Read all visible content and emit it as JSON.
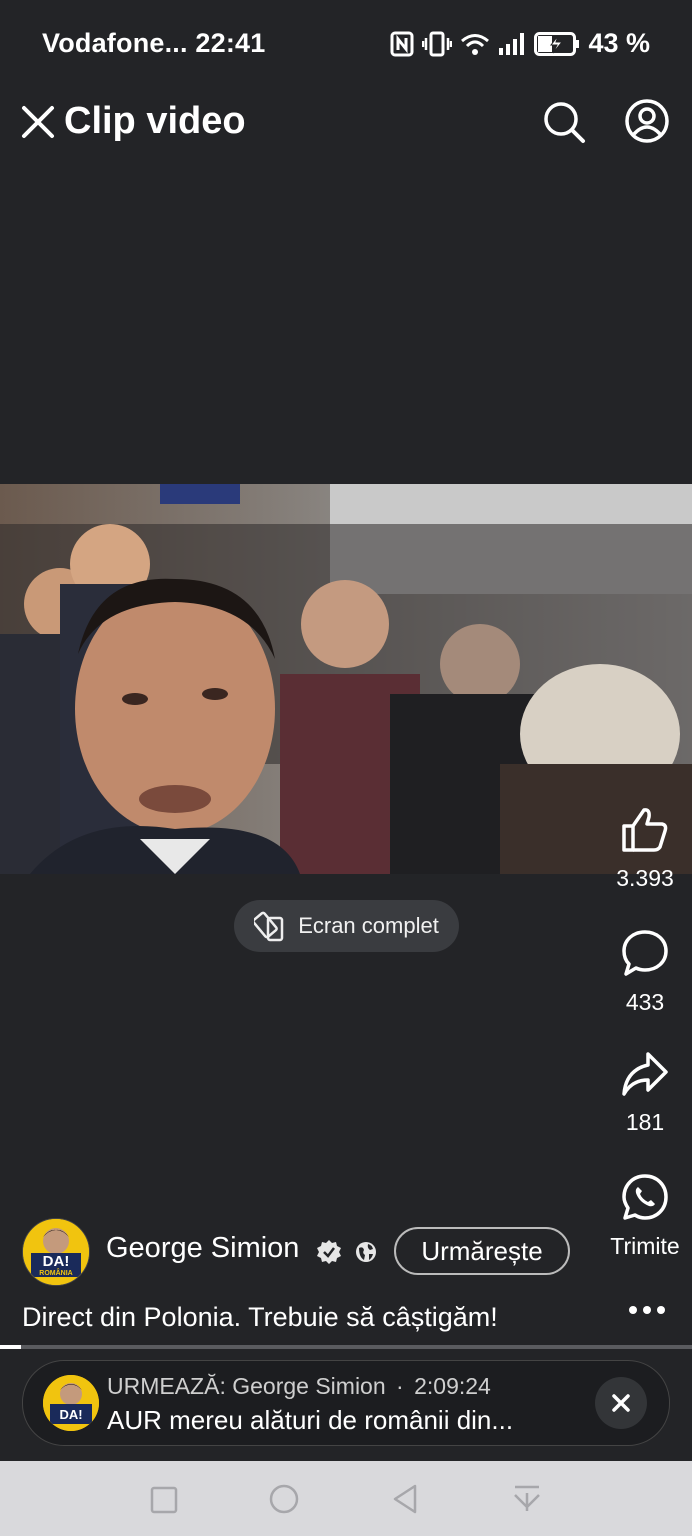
{
  "status_bar": {
    "carrier": "Vodafone...",
    "time": "22:41",
    "battery": "43 %"
  },
  "header": {
    "title": "Clip video"
  },
  "player": {
    "fullscreen_label": "Ecran complet"
  },
  "actions": {
    "likes": "3.393",
    "comments": "433",
    "shares": "181",
    "send_label": "Trimite"
  },
  "channel": {
    "name": "George Simion",
    "follow_label": "Urmărește",
    "avatar_text": "DA!",
    "avatar_subtext": "ROMÂNIA"
  },
  "video": {
    "caption": "Direct din Polonia. Trebuie să câștigăm!",
    "progress": 0.03
  },
  "up_next": {
    "label": "URMEAZĂ: George Simion",
    "separator": "·",
    "duration": "2:09:24",
    "title": "AUR mereu alături de românii din..."
  },
  "colors": {
    "background": "#232427",
    "nav_bar": "#d9d9dc",
    "avatar_yellow": "#f1c40f"
  }
}
